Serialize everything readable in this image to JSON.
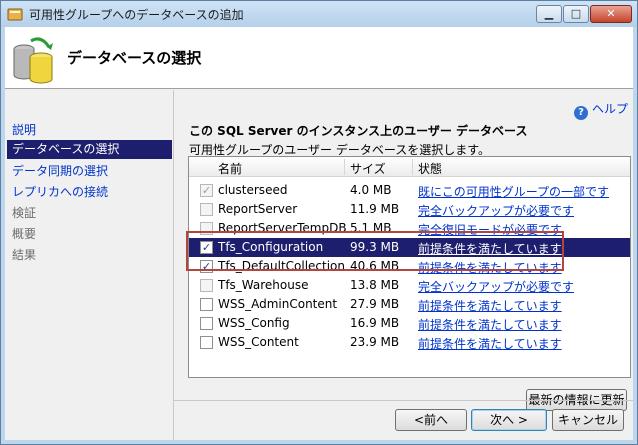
{
  "window": {
    "title": "可用性グループへのデータベースの追加",
    "controls": {
      "minimize": "▁",
      "maximize": "□",
      "close": "✕"
    }
  },
  "header": {
    "title": "データベースの選択",
    "icon": "database-wizard-icon"
  },
  "nav": {
    "items": [
      {
        "label": "説明",
        "state": "link"
      },
      {
        "label": "データベースの選択",
        "state": "selected"
      },
      {
        "label": "データ同期の選択",
        "state": "link"
      },
      {
        "label": "レプリカへの接続",
        "state": "link"
      },
      {
        "label": "検証",
        "state": "disabled"
      },
      {
        "label": "概要",
        "state": "disabled"
      },
      {
        "label": "結果",
        "state": "disabled"
      }
    ]
  },
  "help": {
    "label": "ヘルプ",
    "icon": "help-icon"
  },
  "section": {
    "heading": "この SQL Server のインスタンス上のユーザー データベース",
    "description": "可用性グループのユーザー データベースを選択します。"
  },
  "grid": {
    "columns": [
      "名前",
      "サイズ",
      "状態"
    ],
    "rows": [
      {
        "checked": true,
        "disabled": true,
        "name": "clusterseed",
        "size": "4.0 MB",
        "status": "既にこの可用性グループの一部です"
      },
      {
        "checked": false,
        "disabled": true,
        "name": "ReportServer",
        "size": "11.9 MB",
        "status": "完全バックアップが必要です"
      },
      {
        "checked": false,
        "disabled": true,
        "name": "ReportServerTempDB",
        "size": "5.1 MB",
        "status": "完全復旧モードが必要です"
      },
      {
        "checked": true,
        "disabled": false,
        "selected": true,
        "name": "Tfs_Configuration",
        "size": "99.3 MB",
        "status": "前提条件を満たしています"
      },
      {
        "checked": true,
        "disabled": false,
        "name": "Tfs_DefaultCollection",
        "size": "40.6 MB",
        "status": "前提条件を満たしています"
      },
      {
        "checked": false,
        "disabled": true,
        "name": "Tfs_Warehouse",
        "size": "13.8 MB",
        "status": "完全バックアップが必要です"
      },
      {
        "checked": false,
        "disabled": false,
        "name": "WSS_AdminContent",
        "size": "27.9 MB",
        "status": "前提条件を満たしています"
      },
      {
        "checked": false,
        "disabled": false,
        "name": "WSS_Config",
        "size": "16.9 MB",
        "status": "前提条件を満たしています"
      },
      {
        "checked": false,
        "disabled": false,
        "name": "WSS_Content",
        "size": "23.9 MB",
        "status": "前提条件を満たしています"
      }
    ]
  },
  "buttons": {
    "refresh": "最新の情報に更新",
    "back": "<前へ",
    "next": "次へ >",
    "cancel": "キャンセル"
  },
  "colors": {
    "selection": "#1e1e6e",
    "link": "#0033cc",
    "highlight": "#b0463c"
  }
}
